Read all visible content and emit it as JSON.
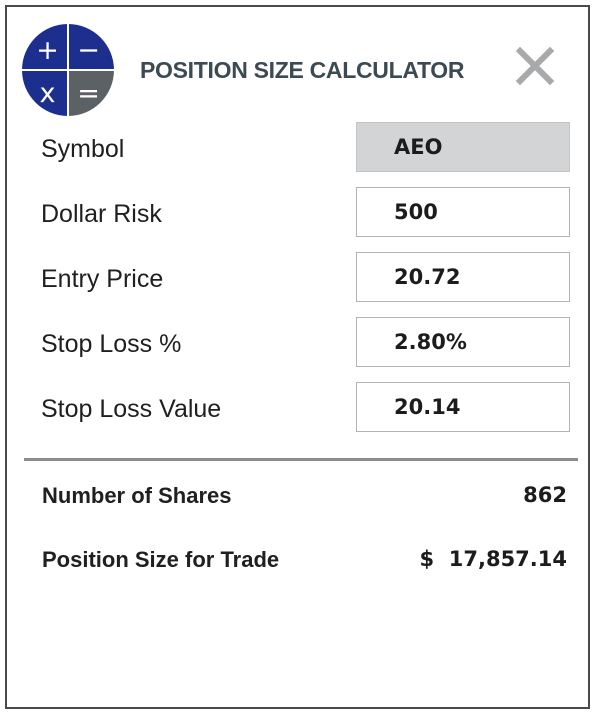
{
  "header": {
    "title": "POSITION SIZE CALCULATOR",
    "logo_symbols": [
      "+",
      "−",
      "x",
      "="
    ],
    "close_icon": "close-x-icon"
  },
  "form": {
    "symbol": {
      "label": "Symbol",
      "value": "AEO"
    },
    "dollar_risk": {
      "label": "Dollar Risk",
      "value": "500"
    },
    "entry_price": {
      "label": "Entry Price",
      "value": "20.72"
    },
    "stop_loss_pct": {
      "label": "Stop Loss %",
      "value": "2.80%"
    },
    "stop_loss_value": {
      "label": "Stop Loss Value",
      "value": "20.14"
    }
  },
  "results": {
    "shares": {
      "label": "Number of Shares",
      "value": "862"
    },
    "position_size": {
      "label": "Position Size for Trade",
      "value": "$  17,857.14"
    }
  },
  "colors": {
    "logo_blue": "#1c2f8f",
    "logo_gray": "#5c6166",
    "title": "#3c4a54",
    "readonly_field": "#d2d4d6",
    "divider": "#8a8d90"
  }
}
